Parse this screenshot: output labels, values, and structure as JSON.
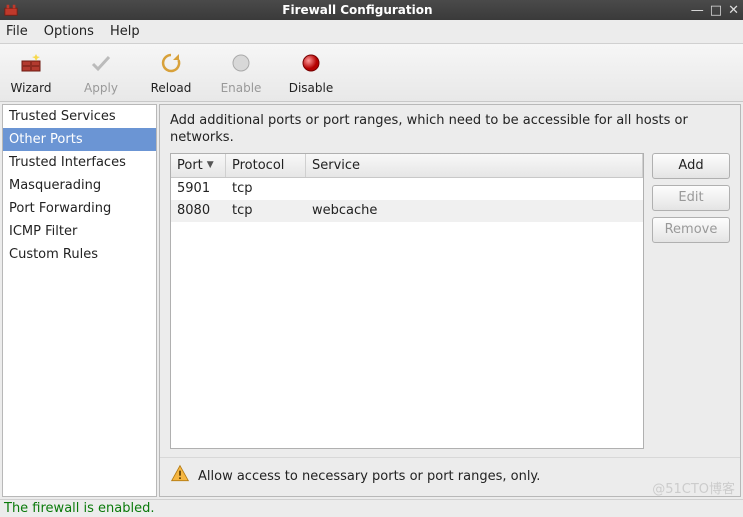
{
  "titlebar": {
    "title": "Firewall Configuration"
  },
  "menubar": {
    "items": [
      "File",
      "Options",
      "Help"
    ]
  },
  "toolbar": {
    "wizard": "Wizard",
    "apply": "Apply",
    "reload": "Reload",
    "enable": "Enable",
    "disable": "Disable"
  },
  "sidebar": {
    "items": [
      "Trusted Services",
      "Other Ports",
      "Trusted Interfaces",
      "Masquerading",
      "Port Forwarding",
      "ICMP Filter",
      "Custom Rules"
    ],
    "selected_index": 1
  },
  "panel": {
    "description": "Add additional ports or port ranges, which need to be accessible for all hosts or networks.",
    "columns": {
      "port": "Port",
      "protocol": "Protocol",
      "service": "Service"
    },
    "rows": [
      {
        "port": "5901",
        "protocol": "tcp",
        "service": ""
      },
      {
        "port": "8080",
        "protocol": "tcp",
        "service": "webcache"
      }
    ],
    "buttons": {
      "add": "Add",
      "edit": "Edit",
      "remove": "Remove"
    },
    "hint": "Allow access to necessary ports or port ranges, only."
  },
  "status": "The firewall is enabled.",
  "watermark": "@51CTO博客"
}
